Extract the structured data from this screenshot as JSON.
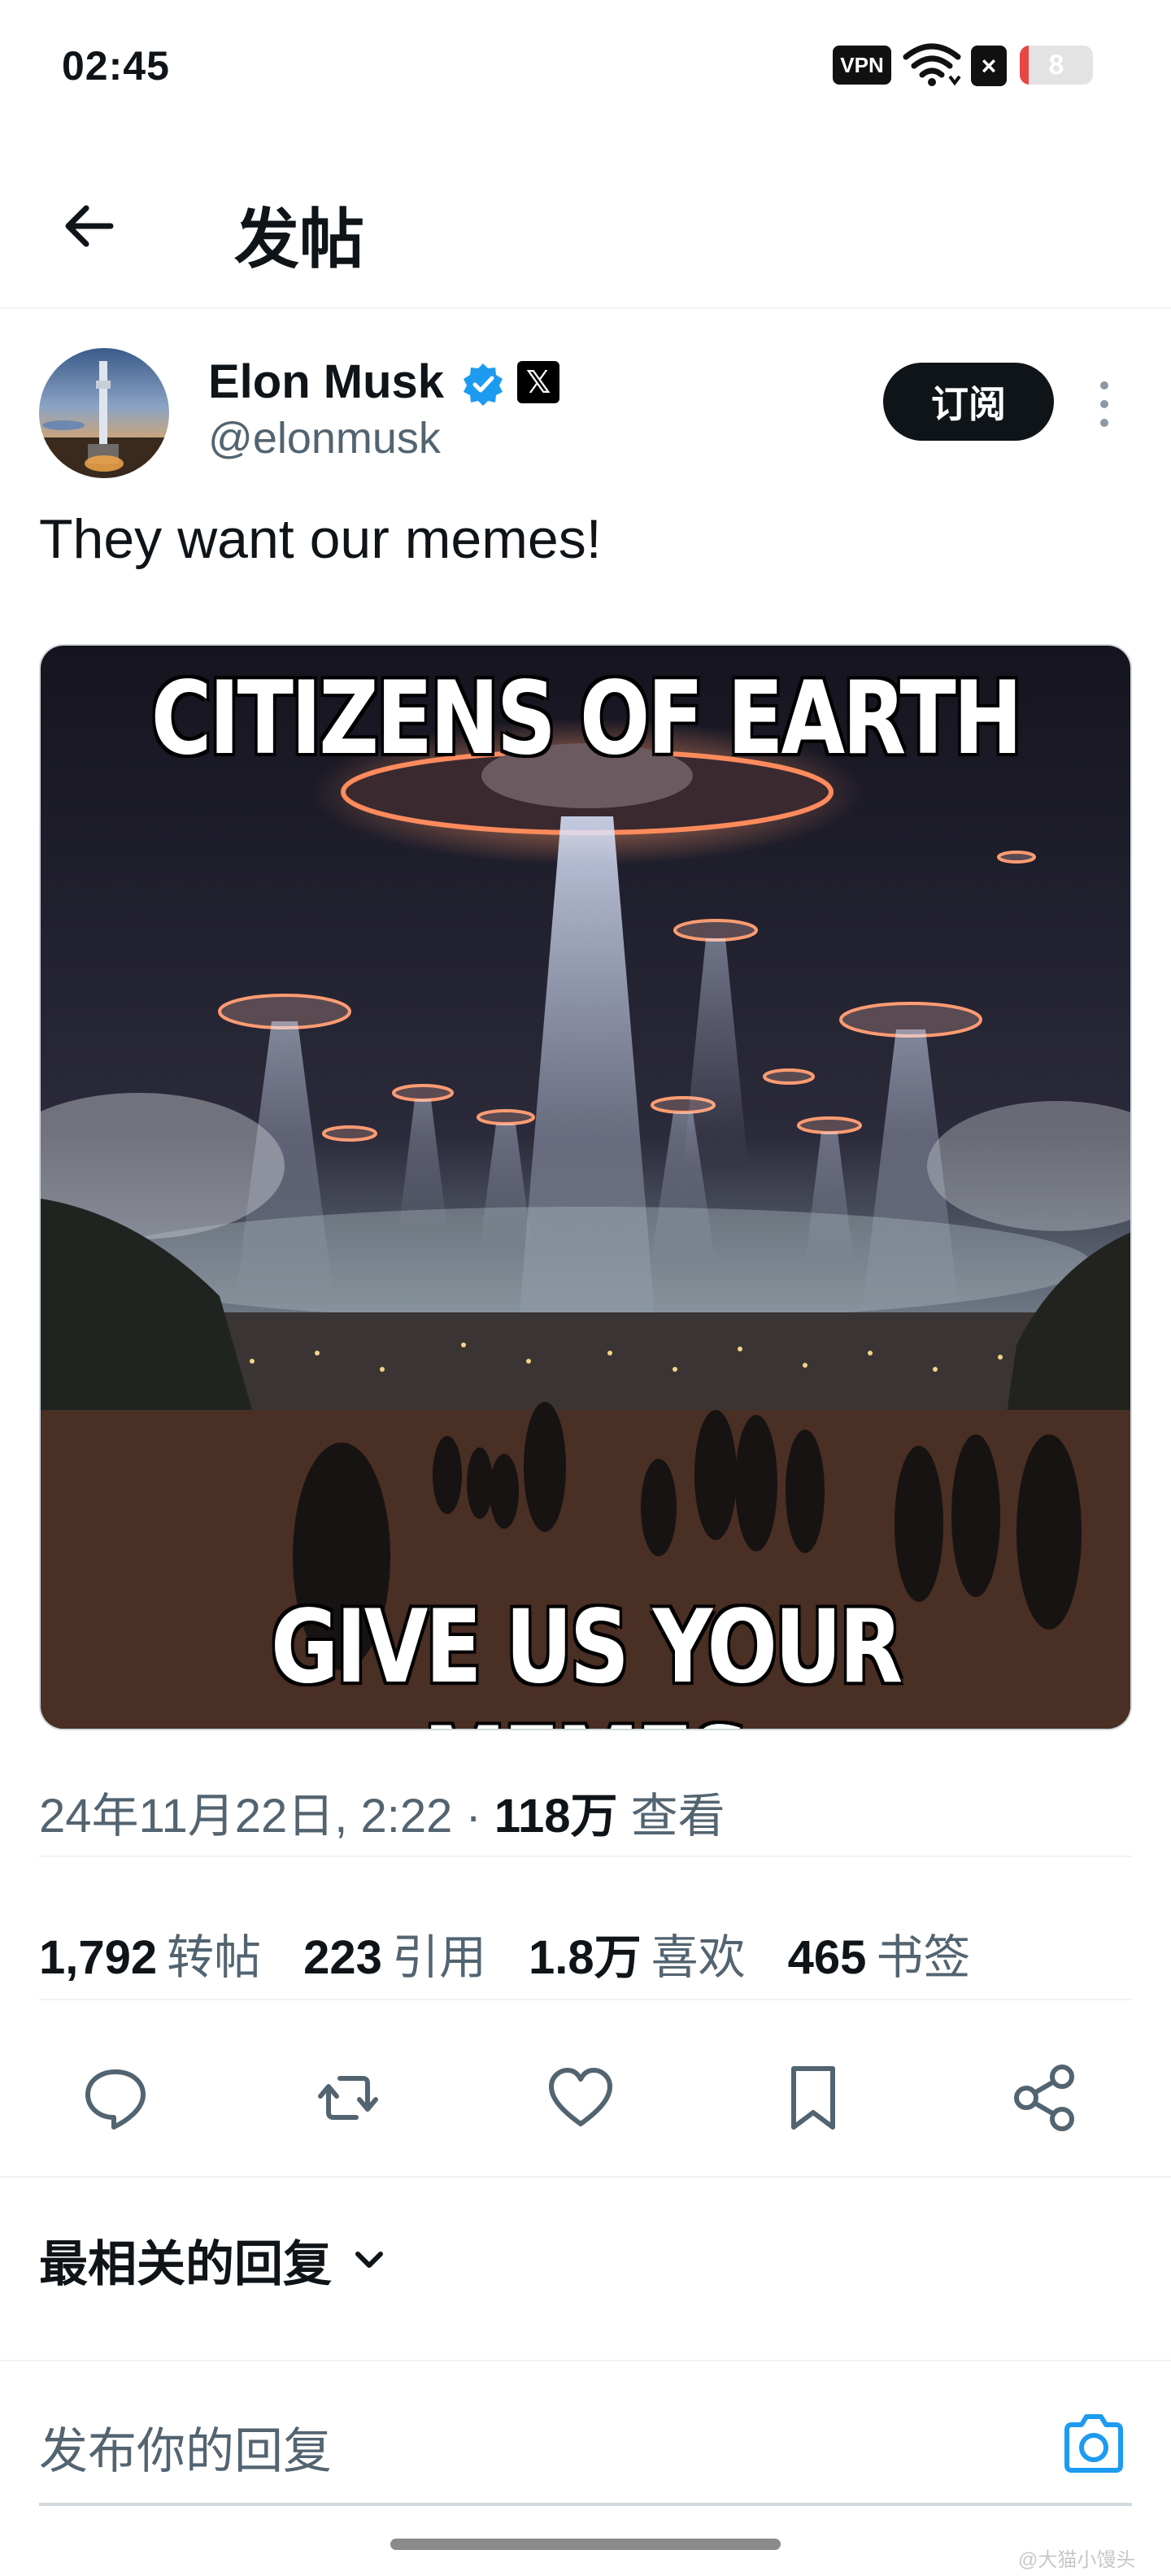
{
  "status_bar": {
    "time": "02:45",
    "vpn_label": "VPN",
    "battery_text": "8",
    "battery_level": 0.08,
    "battery_color": "#e84545"
  },
  "header": {
    "title": "发帖",
    "back_icon": "arrow-left-icon"
  },
  "post": {
    "author": {
      "display_name": "Elon Musk",
      "handle": "@elonmusk",
      "x_badge": "𝕏",
      "verified_color": "#1d9bf0"
    },
    "subscribe_label": "订阅",
    "text": "They want our memes!",
    "media": {
      "top_caption": "CITIZENS OF EARTH",
      "bottom_caption": "GIVE US YOUR MEMES"
    },
    "meta": {
      "datetime": "24年11月22日, 2:22 · ",
      "views_count": "118万",
      "views_label": " 查看"
    },
    "stats": [
      {
        "count": "1,792",
        "label": "转帖"
      },
      {
        "count": "223",
        "label": "引用"
      },
      {
        "count": "1.8万",
        "label": "喜欢"
      },
      {
        "count": "465",
        "label": "书签"
      }
    ],
    "actions": [
      "reply-icon",
      "repost-icon",
      "like-icon",
      "bookmark-icon",
      "share-icon"
    ]
  },
  "replies": {
    "sort_label": "最相关的回复",
    "input_placeholder": "发布你的回复",
    "camera_color": "#1d9bf0"
  },
  "watermark": "@大猫小馒头"
}
